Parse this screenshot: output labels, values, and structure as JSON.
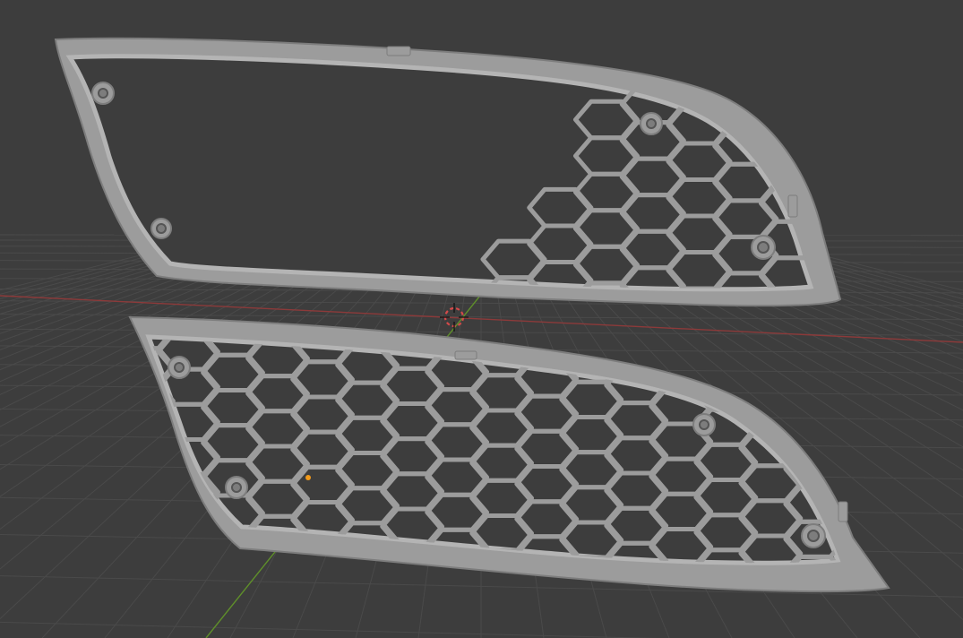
{
  "viewport": {
    "background_color": "#3d3d3d",
    "floor_color": "#353535",
    "grid_line_color": "#4a4a4a",
    "x_axis_color": "#8c3a3a",
    "y_axis_color": "#5f8f2a"
  },
  "model": {
    "mesh_color": "#9c9c9c",
    "mesh_shade_color": "#7d7d7d",
    "mesh_highlight_color": "#b4b4b4",
    "parts": [
      "upper-grille-frame",
      "lower-grille-mesh"
    ]
  },
  "gizmos": {
    "cursor_icon": "3d-cursor-icon",
    "cursor_ring_color": "#d44a4a",
    "origin_icon": "object-origin-icon",
    "origin_color": "#f29a1a"
  }
}
